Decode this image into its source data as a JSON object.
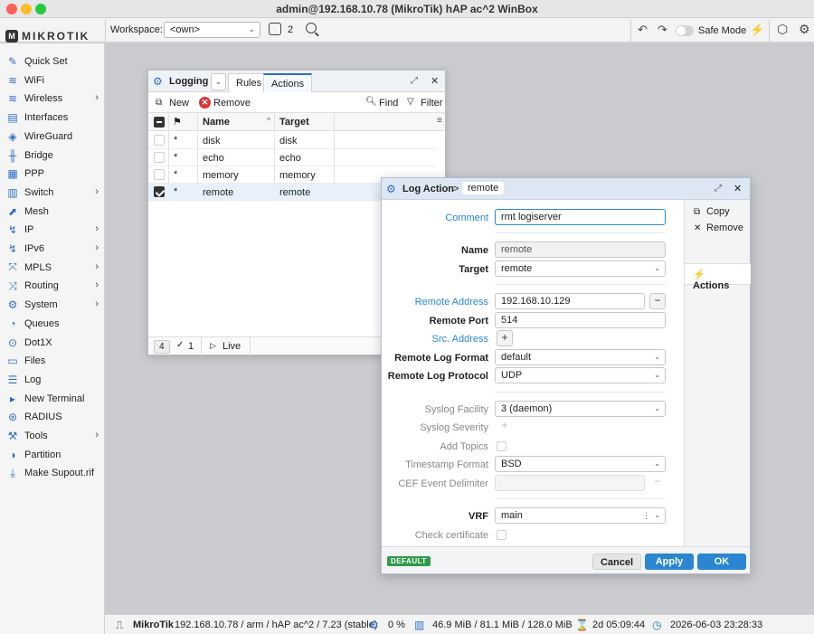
{
  "window": {
    "title": "admin@192.168.10.78 (MikroTik) hAP ac^2 WinBox"
  },
  "toolbar": {
    "brand": "MIKROTIK",
    "workspace_label": "Workspace:",
    "workspace_value": "<own>",
    "window_count": "2",
    "safe_mode_label": "Safe Mode"
  },
  "sidebar": {
    "items": [
      {
        "label": "Quick Set",
        "icon": "wand-icon",
        "arrow": false
      },
      {
        "label": "WiFi",
        "icon": "wifi-icon",
        "arrow": false
      },
      {
        "label": "Wireless",
        "icon": "wireless-icon",
        "arrow": true
      },
      {
        "label": "Interfaces",
        "icon": "interfaces-icon",
        "arrow": false
      },
      {
        "label": "WireGuard",
        "icon": "wireguard-icon",
        "arrow": false
      },
      {
        "label": "Bridge",
        "icon": "bridge-icon",
        "arrow": false
      },
      {
        "label": "PPP",
        "icon": "ppp-icon",
        "arrow": false
      },
      {
        "label": "Switch",
        "icon": "switch-icon",
        "arrow": true
      },
      {
        "label": "Mesh",
        "icon": "mesh-icon",
        "arrow": false
      },
      {
        "label": "IP",
        "icon": "ip-icon",
        "arrow": true
      },
      {
        "label": "IPv6",
        "icon": "ipv6-icon",
        "arrow": true
      },
      {
        "label": "MPLS",
        "icon": "mpls-icon",
        "arrow": true
      },
      {
        "label": "Routing",
        "icon": "routing-icon",
        "arrow": true
      },
      {
        "label": "System",
        "icon": "system-gear-icon",
        "arrow": true
      },
      {
        "label": "Queues",
        "icon": "queues-icon",
        "arrow": false
      },
      {
        "label": "Dot1X",
        "icon": "dot1x-icon",
        "arrow": false
      },
      {
        "label": "Files",
        "icon": "files-icon",
        "arrow": false
      },
      {
        "label": "Log",
        "icon": "log-icon",
        "arrow": false
      },
      {
        "label": "New Terminal",
        "icon": "terminal-icon",
        "arrow": false
      },
      {
        "label": "RADIUS",
        "icon": "radius-icon",
        "arrow": false
      },
      {
        "label": "Tools",
        "icon": "tools-icon",
        "arrow": true
      },
      {
        "label": "Partition",
        "icon": "partition-icon",
        "arrow": false
      },
      {
        "label": "Make Supout.rif",
        "icon": "supout-icon",
        "arrow": false
      }
    ]
  },
  "logging": {
    "title": "Logging",
    "tabs": [
      "Rules",
      "Actions"
    ],
    "active_tab": "Actions",
    "new_label": "New",
    "remove_label": "Remove",
    "find_label": "Find",
    "filter_label": "Filter",
    "columns": [
      "Name",
      "Target"
    ],
    "rows": [
      {
        "name": "disk",
        "target": "disk",
        "selected": false
      },
      {
        "name": "echo",
        "target": "echo",
        "selected": false
      },
      {
        "name": "memory",
        "target": "memory",
        "selected": false
      },
      {
        "name": "remote",
        "target": "remote",
        "selected": true
      }
    ],
    "status": {
      "count": "4",
      "selected": "1",
      "live_label": "Live"
    }
  },
  "log_action": {
    "title": "Log Action",
    "crumb_sep": ">",
    "crumb": "remote",
    "side": {
      "copy": "Copy",
      "remove": "Remove",
      "actions": "Actions"
    },
    "fields": {
      "comment_label": "Comment",
      "comment_value": "rmt logiserver",
      "name_label": "Name",
      "name_value": "remote",
      "target_label": "Target",
      "target_value": "remote",
      "remote_address_label": "Remote Address",
      "remote_address_value": "192.168.10.129",
      "remote_port_label": "Remote Port",
      "remote_port_value": "514",
      "src_address_label": "Src. Address",
      "remote_log_format_label": "Remote Log Format",
      "remote_log_format_value": "default",
      "remote_log_protocol_label": "Remote Log Protocol",
      "remote_log_protocol_value": "UDP",
      "syslog_facility_label": "Syslog Facility",
      "syslog_facility_value": "3 (daemon)",
      "syslog_severity_label": "Syslog Severity",
      "add_topics_label": "Add Topics",
      "timestamp_format_label": "Timestamp Format",
      "timestamp_format_value": "BSD",
      "cef_delimiter_label": "CEF Event Delimiter",
      "vrf_label": "VRF",
      "vrf_value": "main",
      "check_certificate_label": "Check certificate"
    },
    "footer": {
      "badge": "DEFAULT",
      "cancel": "Cancel",
      "apply": "Apply",
      "ok": "OK"
    }
  },
  "statusbar": {
    "brand": "MikroTik",
    "info": "192.168.10.78 / arm / hAP ac^2 / 7.23 (stable)",
    "cpu": "0 %",
    "memory": "46.9 MiB / 81.1 MiB / 128.0 MiB",
    "uptime": "2d 05:09:44",
    "datetime": "2026-06-03 23:28:33"
  }
}
